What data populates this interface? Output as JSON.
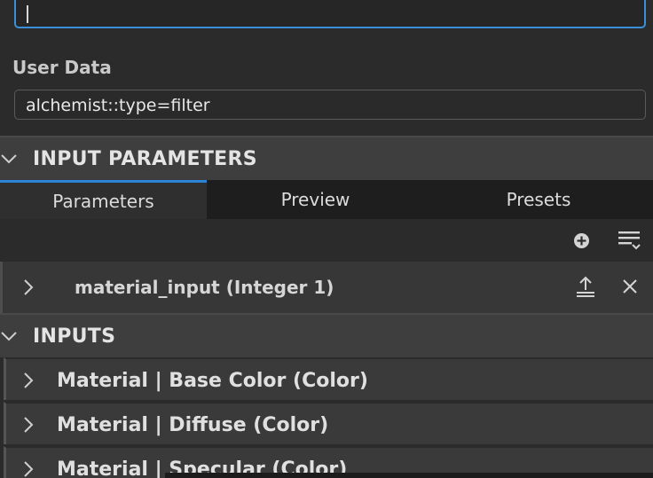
{
  "user_data": {
    "label": "User Data",
    "value": "alchemist::type=filter"
  },
  "input_parameters": {
    "title": "INPUT PARAMETERS",
    "tabs": [
      {
        "label": "Parameters",
        "active": true
      },
      {
        "label": "Preview",
        "active": false
      },
      {
        "label": "Presets",
        "active": false
      }
    ],
    "toolbar": {
      "add_icon": "add-circle-icon",
      "options_icon": "list-options-icon"
    },
    "items": [
      {
        "label": "material_input (Integer 1)",
        "actions": [
          "export-icon",
          "close-icon"
        ]
      }
    ]
  },
  "inputs": {
    "title": "INPUTS",
    "items": [
      {
        "label": "Material | Base Color (Color)"
      },
      {
        "label": "Material | Diffuse (Color)"
      },
      {
        "label": "Material | Specular (Color)"
      }
    ]
  },
  "colors": {
    "accent": "#2d84d6",
    "background": "#2b2b2b",
    "header": "#3e3e3e"
  }
}
